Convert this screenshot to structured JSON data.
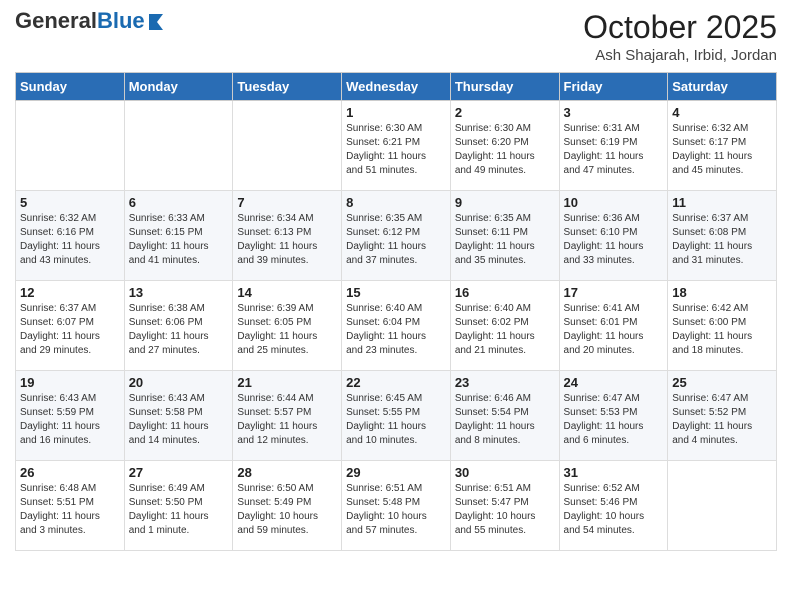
{
  "header": {
    "logo_general": "General",
    "logo_blue": "Blue",
    "month": "October 2025",
    "location": "Ash Shajarah, Irbid, Jordan"
  },
  "days_of_week": [
    "Sunday",
    "Monday",
    "Tuesday",
    "Wednesday",
    "Thursday",
    "Friday",
    "Saturday"
  ],
  "weeks": [
    [
      {
        "day": "",
        "info": ""
      },
      {
        "day": "",
        "info": ""
      },
      {
        "day": "",
        "info": ""
      },
      {
        "day": "1",
        "info": "Sunrise: 6:30 AM\nSunset: 6:21 PM\nDaylight: 11 hours\nand 51 minutes."
      },
      {
        "day": "2",
        "info": "Sunrise: 6:30 AM\nSunset: 6:20 PM\nDaylight: 11 hours\nand 49 minutes."
      },
      {
        "day": "3",
        "info": "Sunrise: 6:31 AM\nSunset: 6:19 PM\nDaylight: 11 hours\nand 47 minutes."
      },
      {
        "day": "4",
        "info": "Sunrise: 6:32 AM\nSunset: 6:17 PM\nDaylight: 11 hours\nand 45 minutes."
      }
    ],
    [
      {
        "day": "5",
        "info": "Sunrise: 6:32 AM\nSunset: 6:16 PM\nDaylight: 11 hours\nand 43 minutes."
      },
      {
        "day": "6",
        "info": "Sunrise: 6:33 AM\nSunset: 6:15 PM\nDaylight: 11 hours\nand 41 minutes."
      },
      {
        "day": "7",
        "info": "Sunrise: 6:34 AM\nSunset: 6:13 PM\nDaylight: 11 hours\nand 39 minutes."
      },
      {
        "day": "8",
        "info": "Sunrise: 6:35 AM\nSunset: 6:12 PM\nDaylight: 11 hours\nand 37 minutes."
      },
      {
        "day": "9",
        "info": "Sunrise: 6:35 AM\nSunset: 6:11 PM\nDaylight: 11 hours\nand 35 minutes."
      },
      {
        "day": "10",
        "info": "Sunrise: 6:36 AM\nSunset: 6:10 PM\nDaylight: 11 hours\nand 33 minutes."
      },
      {
        "day": "11",
        "info": "Sunrise: 6:37 AM\nSunset: 6:08 PM\nDaylight: 11 hours\nand 31 minutes."
      }
    ],
    [
      {
        "day": "12",
        "info": "Sunrise: 6:37 AM\nSunset: 6:07 PM\nDaylight: 11 hours\nand 29 minutes."
      },
      {
        "day": "13",
        "info": "Sunrise: 6:38 AM\nSunset: 6:06 PM\nDaylight: 11 hours\nand 27 minutes."
      },
      {
        "day": "14",
        "info": "Sunrise: 6:39 AM\nSunset: 6:05 PM\nDaylight: 11 hours\nand 25 minutes."
      },
      {
        "day": "15",
        "info": "Sunrise: 6:40 AM\nSunset: 6:04 PM\nDaylight: 11 hours\nand 23 minutes."
      },
      {
        "day": "16",
        "info": "Sunrise: 6:40 AM\nSunset: 6:02 PM\nDaylight: 11 hours\nand 21 minutes."
      },
      {
        "day": "17",
        "info": "Sunrise: 6:41 AM\nSunset: 6:01 PM\nDaylight: 11 hours\nand 20 minutes."
      },
      {
        "day": "18",
        "info": "Sunrise: 6:42 AM\nSunset: 6:00 PM\nDaylight: 11 hours\nand 18 minutes."
      }
    ],
    [
      {
        "day": "19",
        "info": "Sunrise: 6:43 AM\nSunset: 5:59 PM\nDaylight: 11 hours\nand 16 minutes."
      },
      {
        "day": "20",
        "info": "Sunrise: 6:43 AM\nSunset: 5:58 PM\nDaylight: 11 hours\nand 14 minutes."
      },
      {
        "day": "21",
        "info": "Sunrise: 6:44 AM\nSunset: 5:57 PM\nDaylight: 11 hours\nand 12 minutes."
      },
      {
        "day": "22",
        "info": "Sunrise: 6:45 AM\nSunset: 5:55 PM\nDaylight: 11 hours\nand 10 minutes."
      },
      {
        "day": "23",
        "info": "Sunrise: 6:46 AM\nSunset: 5:54 PM\nDaylight: 11 hours\nand 8 minutes."
      },
      {
        "day": "24",
        "info": "Sunrise: 6:47 AM\nSunset: 5:53 PM\nDaylight: 11 hours\nand 6 minutes."
      },
      {
        "day": "25",
        "info": "Sunrise: 6:47 AM\nSunset: 5:52 PM\nDaylight: 11 hours\nand 4 minutes."
      }
    ],
    [
      {
        "day": "26",
        "info": "Sunrise: 6:48 AM\nSunset: 5:51 PM\nDaylight: 11 hours\nand 3 minutes."
      },
      {
        "day": "27",
        "info": "Sunrise: 6:49 AM\nSunset: 5:50 PM\nDaylight: 11 hours\nand 1 minute."
      },
      {
        "day": "28",
        "info": "Sunrise: 6:50 AM\nSunset: 5:49 PM\nDaylight: 10 hours\nand 59 minutes."
      },
      {
        "day": "29",
        "info": "Sunrise: 6:51 AM\nSunset: 5:48 PM\nDaylight: 10 hours\nand 57 minutes."
      },
      {
        "day": "30",
        "info": "Sunrise: 6:51 AM\nSunset: 5:47 PM\nDaylight: 10 hours\nand 55 minutes."
      },
      {
        "day": "31",
        "info": "Sunrise: 6:52 AM\nSunset: 5:46 PM\nDaylight: 10 hours\nand 54 minutes."
      },
      {
        "day": "",
        "info": ""
      }
    ]
  ]
}
